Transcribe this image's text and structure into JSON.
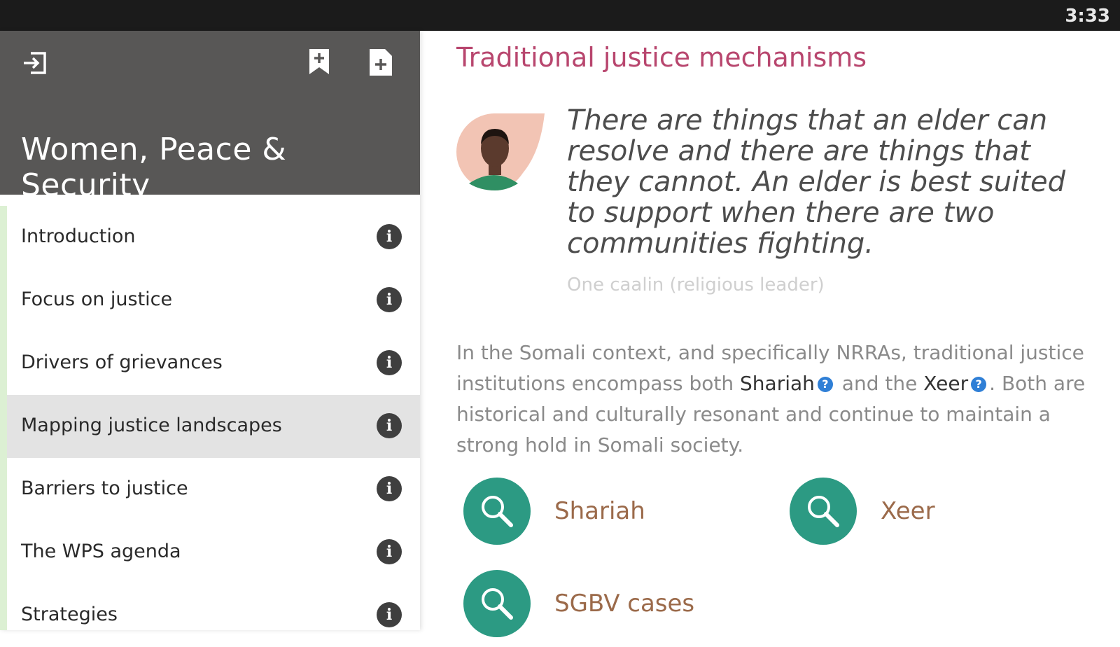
{
  "status_bar": {
    "time": "3:33"
  },
  "sidebar": {
    "app_title": "Women, Peace & Security",
    "icons": {
      "exit": "exit-icon",
      "bookmark": "bookmark-add-icon",
      "note": "note-add-icon"
    },
    "items": [
      {
        "label": "Introduction",
        "active": false
      },
      {
        "label": "Focus on justice",
        "active": false
      },
      {
        "label": "Drivers of grievances",
        "active": false
      },
      {
        "label": "Mapping justice landscapes",
        "active": true
      },
      {
        "label": "Barriers to justice",
        "active": false
      },
      {
        "label": "The WPS agenda",
        "active": false
      },
      {
        "label": "Strategies",
        "active": false
      }
    ]
  },
  "content": {
    "section_title": "Traditional justice mechanisms",
    "quote": "There are things that an elder can resolve and there are things that they cannot. An elder is best suited to support when there are two communities fighting.",
    "attribution": "One caalin (religious leader)",
    "paragraph": {
      "part1": "In the Somali context, and specifically NRRAs, traditional justice institutions encompass both ",
      "term1": "Shariah",
      "part2": " and the ",
      "term2": "Xeer",
      "part3": ". Both are historical and culturally resonant and continue to maintain a strong hold in Somali society."
    },
    "cards": [
      {
        "label": "Shariah"
      },
      {
        "label": "Xeer"
      },
      {
        "label": "SGBV cases"
      }
    ]
  },
  "colors": {
    "header_bg": "#585756",
    "accent_title": "#b8466e",
    "teal": "#2c9a83",
    "card_label": "#9b6a4a",
    "active_row": "#e3e3e3"
  }
}
